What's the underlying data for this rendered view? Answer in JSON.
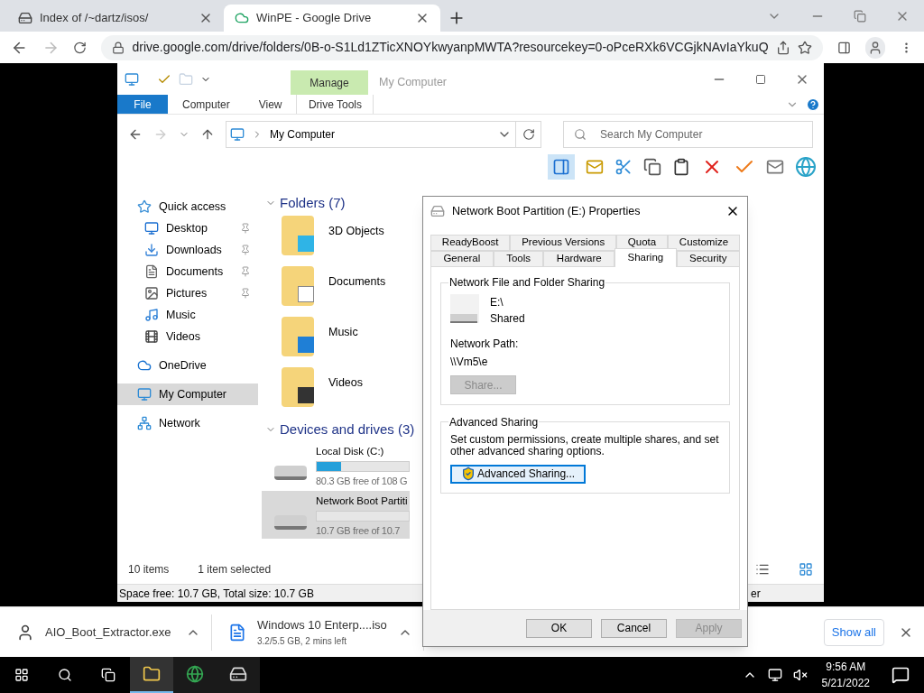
{
  "browser": {
    "tabs": [
      {
        "title": "Index of /~dartz/isos/",
        "selected": false
      },
      {
        "title": "WinPE - Google Drive",
        "selected": true
      }
    ],
    "forward_enabled": false,
    "url": "drive.google.com/drive/folders/0B-o-S1Ld1ZTicXNOYkwyanpMWTA?resourcekey=0-oPceRXk6VCGjkNAvIaYkuQ"
  },
  "explorer": {
    "context_group": "Manage",
    "title": "My Computer",
    "ribbon_tabs": [
      {
        "label": "File",
        "kind": "file"
      },
      {
        "label": "Computer",
        "kind": "plain"
      },
      {
        "label": "View",
        "kind": "plain"
      },
      {
        "label": "Drive Tools",
        "kind": "contextual"
      }
    ],
    "breadcrumb": "My Computer",
    "search": {
      "placeholder": "Search My Computer"
    },
    "sidebar": [
      {
        "label": "Quick access",
        "selected": false,
        "children": [
          {
            "label": "Desktop",
            "pinned": true
          },
          {
            "label": "Downloads",
            "pinned": true
          },
          {
            "label": "Documents",
            "pinned": true
          },
          {
            "label": "Pictures",
            "pinned": true
          },
          {
            "label": "Music",
            "pinned": false
          },
          {
            "label": "Videos",
            "pinned": false
          }
        ]
      },
      {
        "label": "OneDrive",
        "selected": false
      },
      {
        "label": "My Computer",
        "selected": true
      },
      {
        "label": "Network",
        "selected": false
      }
    ],
    "folders": {
      "header": "Folders (7)",
      "items": [
        "3D Objects",
        "Documents",
        "Music",
        "Videos"
      ]
    },
    "drives": {
      "header": "Devices and drives (3)",
      "items": [
        {
          "name": "Local Disk (C:)",
          "free": "80.3 GB free of 108 G",
          "level": 0.26,
          "selected": false
        },
        {
          "name": "Network Boot Partiti",
          "free": "10.7 GB free of 10.7",
          "selected": true
        }
      ]
    },
    "status": {
      "count": "10 items",
      "selection": "1 item selected"
    },
    "bottom_bar": {
      "space": "Space free: 10.7 GB, Total size: 10.7 GB",
      "tail": "er"
    }
  },
  "dialog": {
    "title": "Network Boot Partition (E:) Properties",
    "tab_rows": [
      [
        {
          "label": "ReadyBoost",
          "selected": false
        },
        {
          "label": "Previous Versions",
          "selected": false
        },
        {
          "label": "Quota",
          "selected": false
        },
        {
          "label": "Customize",
          "selected": false
        }
      ],
      [
        {
          "label": "General",
          "selected": false
        },
        {
          "label": "Tools",
          "selected": false
        },
        {
          "label": "Hardware",
          "selected": false
        },
        {
          "label": "Sharing",
          "selected": true
        },
        {
          "label": "Security",
          "selected": false
        }
      ]
    ],
    "sharing": {
      "title": "Network File and Folder Sharing",
      "drive": "E:\\",
      "state": "Shared",
      "path_label": "Network Path:",
      "path": "\\\\Vm5\\e",
      "button": {
        "label": "Share...",
        "disabled": true
      }
    },
    "advanced": {
      "title": "Advanced Sharing",
      "description": "Set custom permissions, create multiple shares, and set other advanced sharing options.",
      "button": "Advanced Sharing..."
    },
    "buttons": [
      {
        "label": "OK",
        "disabled": false
      },
      {
        "label": "Cancel",
        "disabled": false
      },
      {
        "label": "Apply",
        "disabled": true
      }
    ]
  },
  "downloads": {
    "items": [
      {
        "name": "AIO_Boot_Extractor.exe"
      },
      {
        "name": "Windows 10 Enterp....iso",
        "detail": "3.2/5.5 GB, 2 mins left"
      }
    ],
    "show_all": "Show all"
  },
  "taskbar": {
    "apps": [
      {
        "active": true
      },
      {
        "active": false
      },
      {
        "active": false
      }
    ],
    "time": "9:56 AM",
    "date": "5/21/2022"
  }
}
